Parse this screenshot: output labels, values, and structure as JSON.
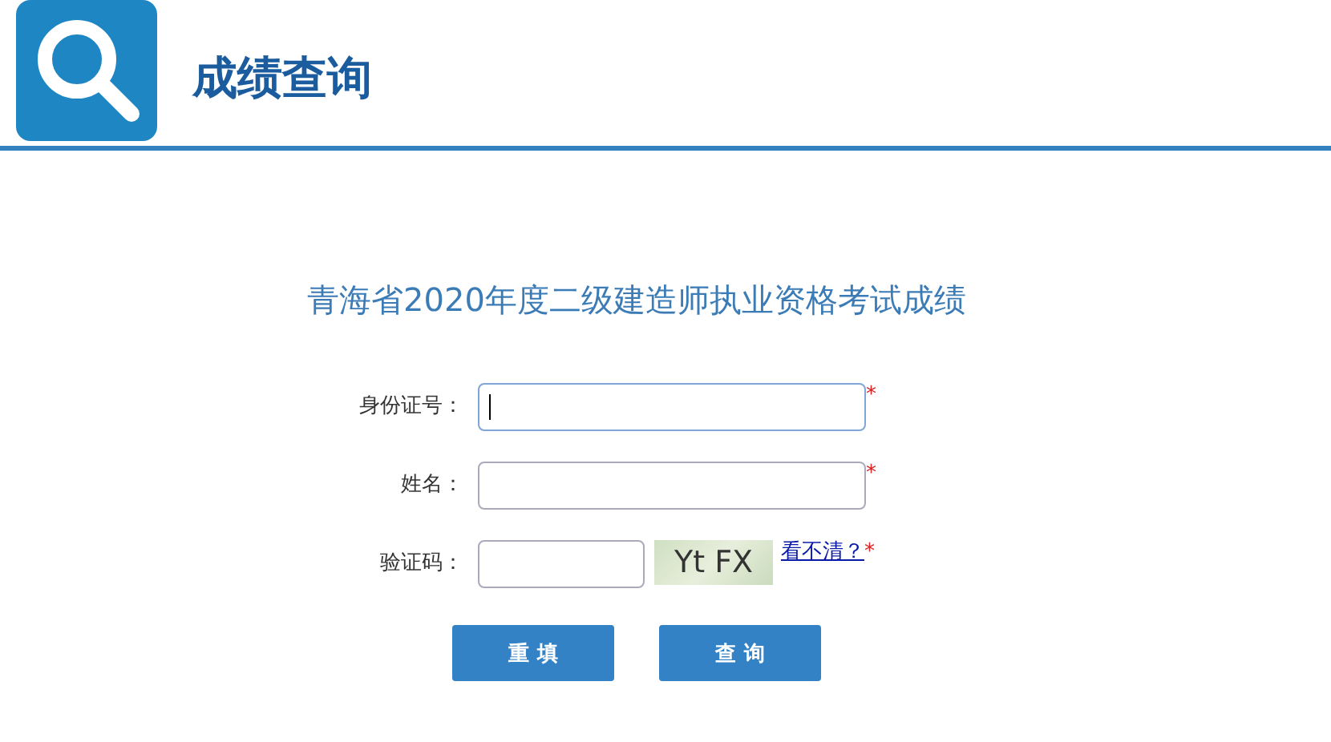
{
  "header": {
    "title": "成绩查询"
  },
  "form": {
    "title": "青海省2020年度二级建造师执业资格考试成绩",
    "fields": [
      {
        "kind": "text",
        "label": "身份证号：",
        "focused": true,
        "required_mark": "*"
      },
      {
        "kind": "text",
        "label": "姓名：",
        "focused": false,
        "required_mark": "*"
      },
      {
        "kind": "captcha",
        "label": "验证码：",
        "focused": false,
        "captcha_code": "Yt FX",
        "refresh_link": "看不清？",
        "required_mark": "*"
      }
    ],
    "buttons": [
      "重 填",
      "查 询"
    ]
  }
}
